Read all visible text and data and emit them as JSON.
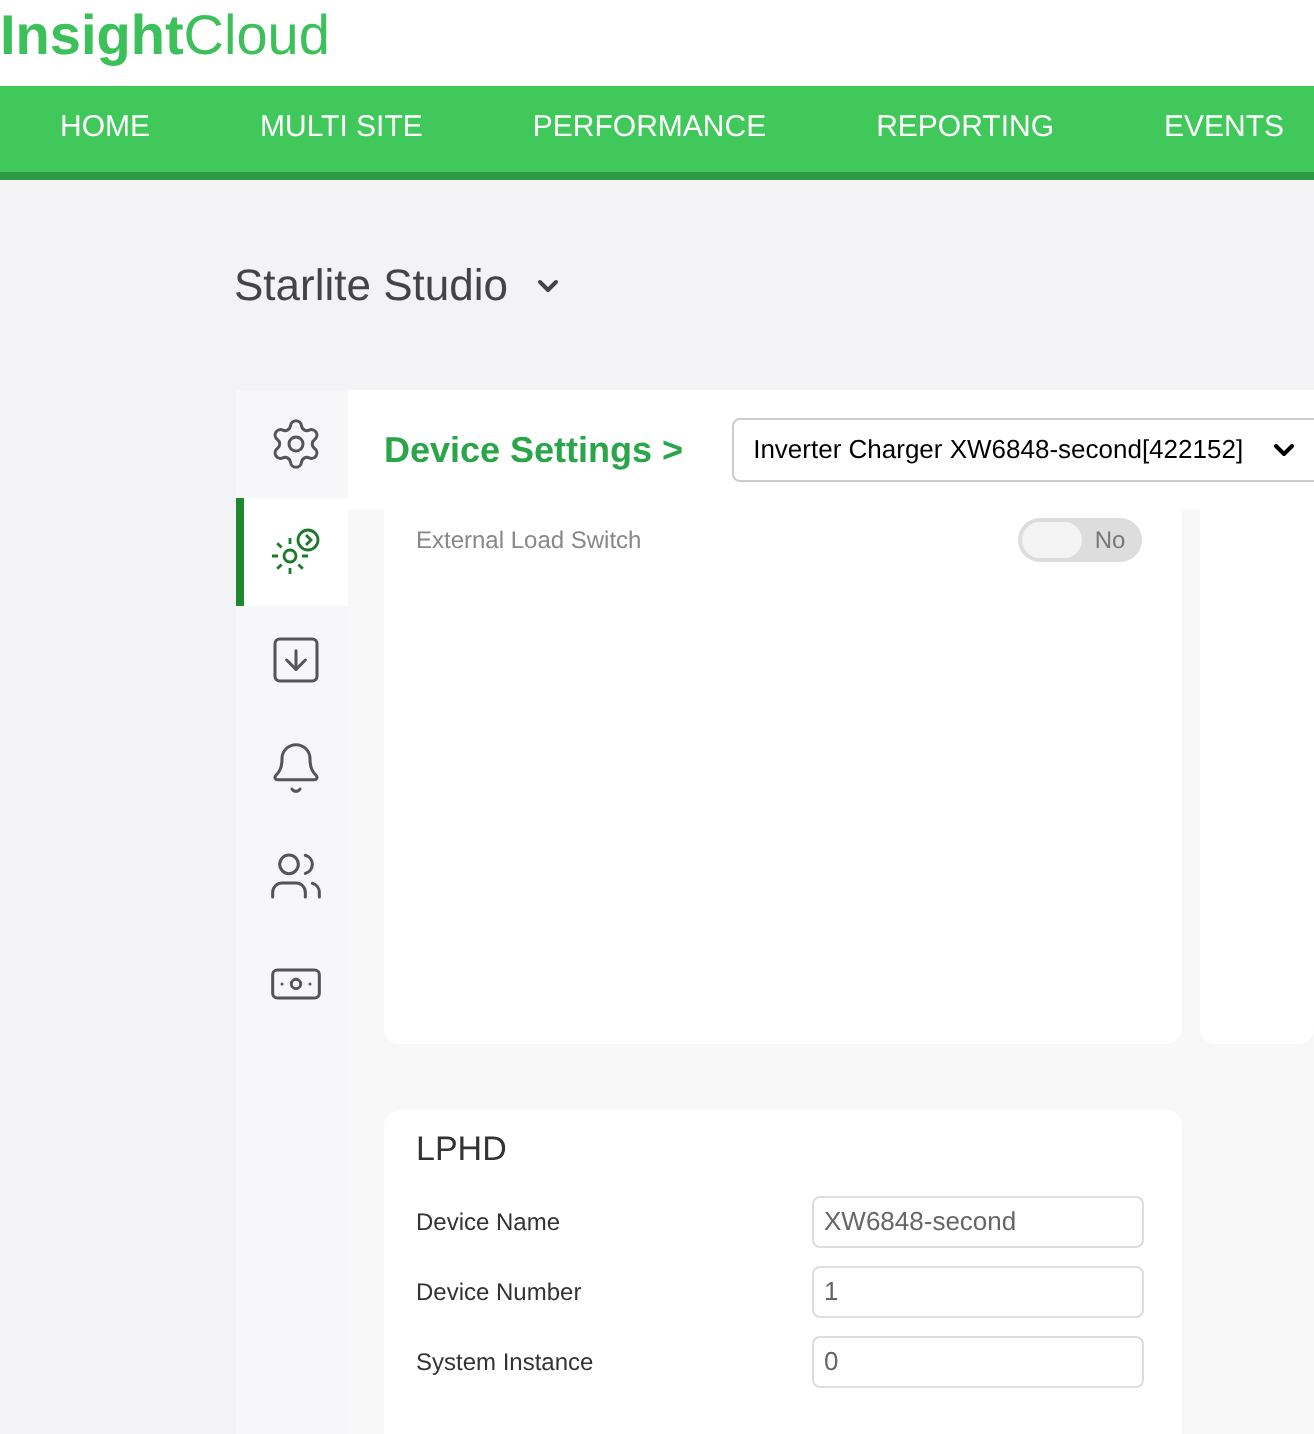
{
  "logo": {
    "part_1": "Insight",
    "part_2": "Cloud"
  },
  "nav": [
    {
      "label": "HOME"
    },
    {
      "label": "MULTI SITE"
    },
    {
      "label": "PERFORMANCE"
    },
    {
      "label": "REPORTING"
    },
    {
      "label": "EVENTS"
    }
  ],
  "site": {
    "title": "Starlite Studio"
  },
  "sidebar": {
    "items": [
      {
        "kind": "settings",
        "selected": false
      },
      {
        "kind": "device-settings",
        "selected": true
      },
      {
        "kind": "download",
        "selected": false
      },
      {
        "kind": "alerts",
        "selected": false
      },
      {
        "kind": "users",
        "selected": false
      },
      {
        "kind": "billing",
        "selected": false
      }
    ]
  },
  "device_settings": {
    "breadcrumb": "Device Settings >",
    "device_select": "Inverter Charger XW6848-second[422152]"
  },
  "settings": [
    {
      "label": "External Load Switch",
      "on": false,
      "toggle_text": "No"
    }
  ],
  "lphd": {
    "title": "LPHD",
    "fields": [
      {
        "label": "Device Name",
        "value": "XW6848-second"
      },
      {
        "label": "Device Number",
        "value": "1"
      },
      {
        "label": "System Instance",
        "value": "0"
      }
    ]
  }
}
